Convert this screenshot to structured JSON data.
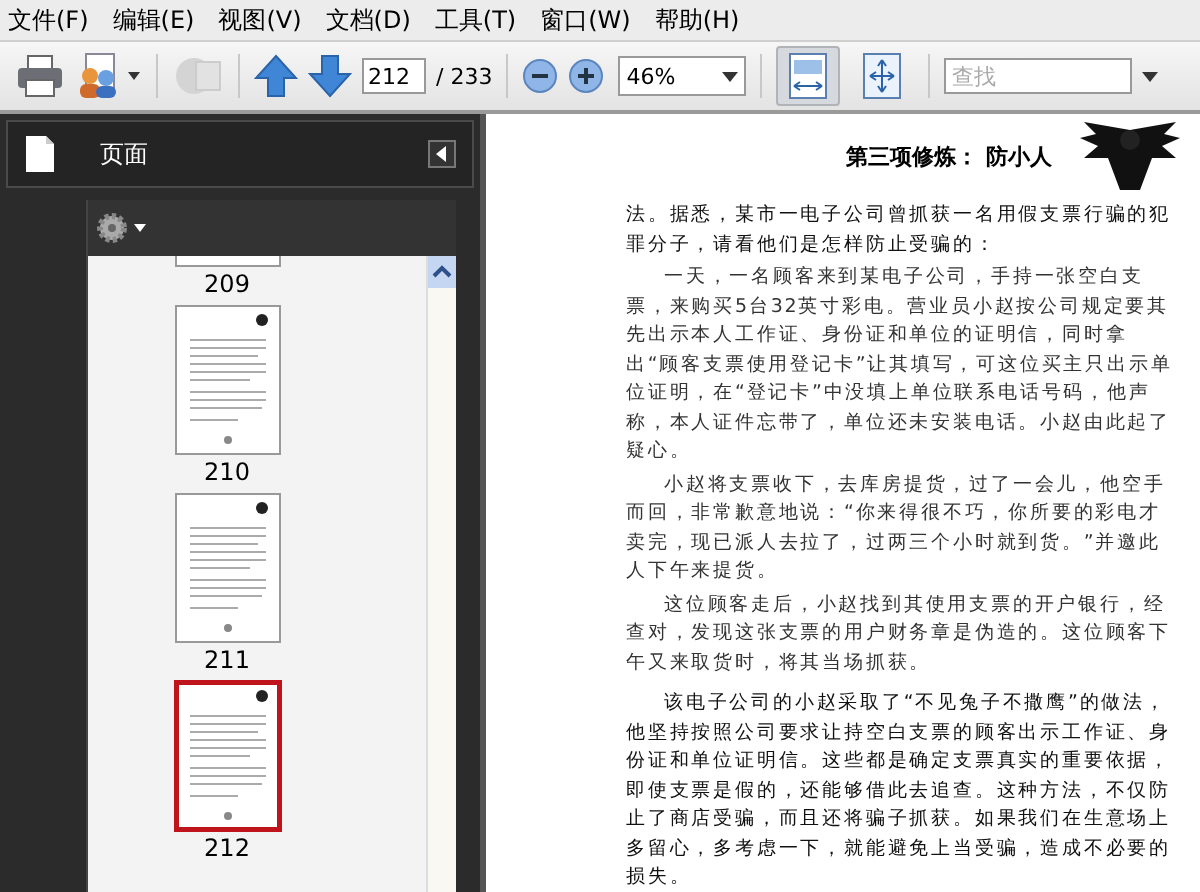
{
  "menu": [
    {
      "label": "文件(F)"
    },
    {
      "label": "编辑(E)"
    },
    {
      "label": "视图(V)"
    },
    {
      "label": "文档(D)"
    },
    {
      "label": "工具(T)"
    },
    {
      "label": "窗口(W)"
    },
    {
      "label": "帮助(H)"
    }
  ],
  "toolbar": {
    "page_field": {
      "value": "212"
    },
    "page_total": "/ 233",
    "zoom_field": {
      "value": "46%"
    },
    "fit_buttons": [
      {
        "kind": "width",
        "selected": true
      },
      {
        "kind": "page",
        "selected": false
      }
    ],
    "search": {
      "placeholder": "查找"
    }
  },
  "sidebar": {
    "title": "页面",
    "thumbnails": [
      {
        "label": "209",
        "selected": false
      },
      {
        "label": "210",
        "selected": false
      },
      {
        "label": "211",
        "selected": false
      },
      {
        "label": "212",
        "selected": true
      }
    ]
  },
  "document": {
    "header": "第三项修炼： 防小人",
    "paragraphs": [
      {
        "kind": "continuation",
        "text": "法。据悉，某市一电子公司曾抓获一名用假支票行骗的犯罪分子，请看他们是怎样防止受骗的："
      },
      {
        "kind": "quote",
        "text": "一天，一名顾客来到某电子公司，手持一张空白支票，来购买5台32英寸彩电。营业员小赵按公司规定要其先出示本人工作证、身份证和单位的证明信，同时拿出“顾客支票使用登记卡”让其填写，可这位买主只出示单位证明，在“登记卡”中没填上单位联系电话号码，他声称，本人证件忘带了，单位还未安装电话。小赵由此起了疑心。"
      },
      {
        "kind": "quote",
        "text": "小赵将支票收下，去库房提货，过了一会儿，他空手而回，非常歉意地说：“你来得很不巧，你所要的彩电才卖完，现已派人去拉了，过两三个小时就到货。”并邀此人下午来提货。"
      },
      {
        "kind": "quote",
        "text": "这位顾客走后，小赵找到其使用支票的开户银行，经查对，发现这张支票的用户财务章是伪造的。这位顾客下午又来取货时，将其当场抓获。"
      },
      {
        "kind": "paragraph",
        "text": "该电子公司的小赵采取了“不见兔子不撒鹰”的做法，他坚持按照公司要求让持空白支票的顾客出示工作证、身份证和单位证明信。这些都是确定支票真实的重要依据，即使支票是假的，还能够借此去追查。这种方法，不仅防止了商店受骗，而且还将骗子抓获。如果我们在生意场上多留心，多考虑一下，就能避免上当受骗，造成不必要的损失。"
      }
    ]
  }
}
